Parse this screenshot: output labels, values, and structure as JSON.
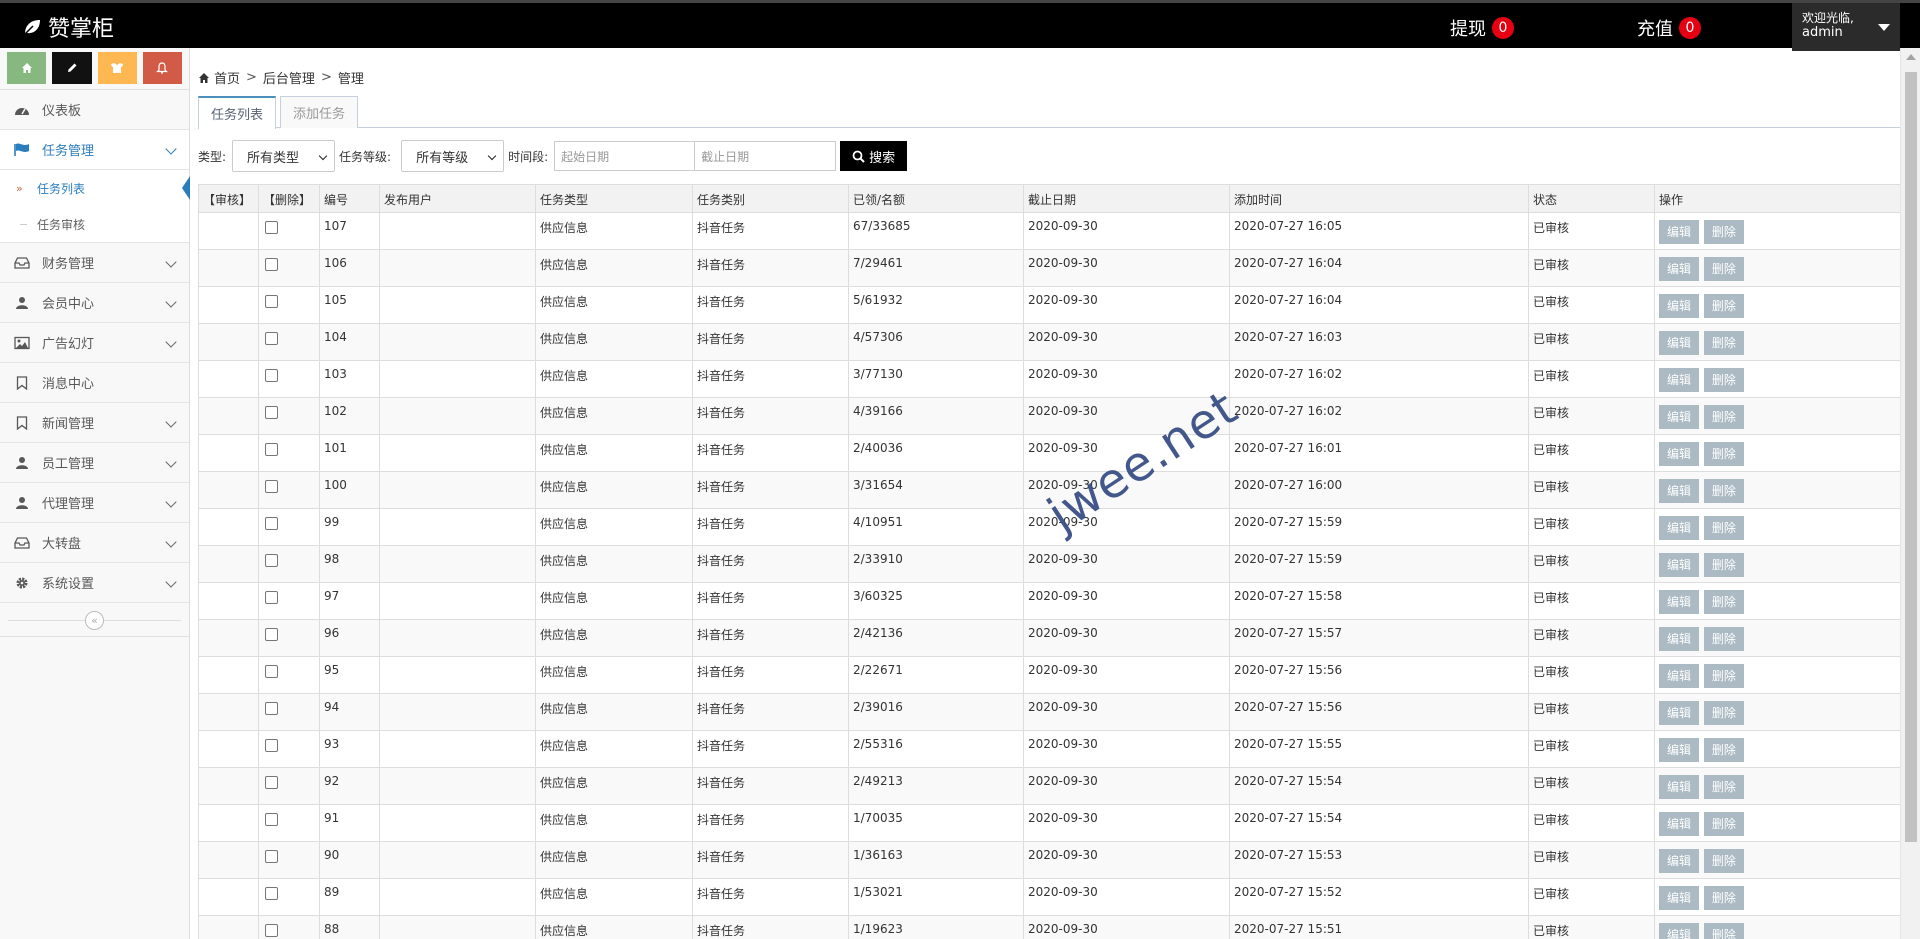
{
  "navbar": {
    "brand": "赞掌柜",
    "withdraw": {
      "label": "提现",
      "count": "0"
    },
    "recharge": {
      "label": "充值",
      "count": "0"
    },
    "user": {
      "welcome": "欢迎光临,",
      "name": "admin"
    }
  },
  "sidebar": {
    "shortcuts": [
      {
        "icon": "home-icon",
        "color": "#87b87f"
      },
      {
        "icon": "pencil-icon",
        "color": "#111111"
      },
      {
        "icon": "users-icon",
        "color": "#ffb752"
      },
      {
        "icon": "bell-icon",
        "color": "#d15b47"
      }
    ],
    "items": {
      "dashboard": "仪表板",
      "tasks": "任务管理",
      "task_list": "任务列表",
      "task_review": "任务审核",
      "finance": "财务管理",
      "members": "会员中心",
      "ads": "广告幻灯",
      "messages": "消息中心",
      "news": "新闻管理",
      "staff": "员工管理",
      "agents": "代理管理",
      "wheel": "大转盘",
      "settings": "系统设置"
    }
  },
  "breadcrumb": {
    "home": "首页",
    "sep1": ">",
    "admin": "后台管理",
    "sep2": ">",
    "manage": "管理"
  },
  "tabs": {
    "list": "任务列表",
    "add": "添加任务"
  },
  "filters": {
    "type_label": "类型:",
    "type_value": "所有类型",
    "level_label": "任务等级:",
    "level_value": "所有等级",
    "period_label": "时间段:",
    "start_placeholder": "起始日期",
    "end_placeholder": "截止日期",
    "search": "搜索"
  },
  "table": {
    "headers": [
      "【审核】",
      "【删除】",
      "编号",
      "发布用户",
      "任务类型",
      "任务类别",
      "已领/名额",
      "截止日期",
      "添加时间",
      "状态",
      "操作"
    ],
    "edit_label": "编辑",
    "delete_label": "删除",
    "rows": [
      {
        "id": "107",
        "type": "供应信息",
        "category": "抖音任务",
        "quota": "67/33685",
        "deadline": "2020-09-30",
        "added": "2020-07-27 16:05",
        "status": "已审核"
      },
      {
        "id": "106",
        "type": "供应信息",
        "category": "抖音任务",
        "quota": "7/29461",
        "deadline": "2020-09-30",
        "added": "2020-07-27 16:04",
        "status": "已审核"
      },
      {
        "id": "105",
        "type": "供应信息",
        "category": "抖音任务",
        "quota": "5/61932",
        "deadline": "2020-09-30",
        "added": "2020-07-27 16:04",
        "status": "已审核"
      },
      {
        "id": "104",
        "type": "供应信息",
        "category": "抖音任务",
        "quota": "4/57306",
        "deadline": "2020-09-30",
        "added": "2020-07-27 16:03",
        "status": "已审核"
      },
      {
        "id": "103",
        "type": "供应信息",
        "category": "抖音任务",
        "quota": "3/77130",
        "deadline": "2020-09-30",
        "added": "2020-07-27 16:02",
        "status": "已审核"
      },
      {
        "id": "102",
        "type": "供应信息",
        "category": "抖音任务",
        "quota": "4/39166",
        "deadline": "2020-09-30",
        "added": "2020-07-27 16:02",
        "status": "已审核"
      },
      {
        "id": "101",
        "type": "供应信息",
        "category": "抖音任务",
        "quota": "2/40036",
        "deadline": "2020-09-30",
        "added": "2020-07-27 16:01",
        "status": "已审核"
      },
      {
        "id": "100",
        "type": "供应信息",
        "category": "抖音任务",
        "quota": "3/31654",
        "deadline": "2020-09-30",
        "added": "2020-07-27 16:00",
        "status": "已审核"
      },
      {
        "id": "99",
        "type": "供应信息",
        "category": "抖音任务",
        "quota": "4/10951",
        "deadline": "2020-09-30",
        "added": "2020-07-27 15:59",
        "status": "已审核"
      },
      {
        "id": "98",
        "type": "供应信息",
        "category": "抖音任务",
        "quota": "2/33910",
        "deadline": "2020-09-30",
        "added": "2020-07-27 15:59",
        "status": "已审核"
      },
      {
        "id": "97",
        "type": "供应信息",
        "category": "抖音任务",
        "quota": "3/60325",
        "deadline": "2020-09-30",
        "added": "2020-07-27 15:58",
        "status": "已审核"
      },
      {
        "id": "96",
        "type": "供应信息",
        "category": "抖音任务",
        "quota": "2/42136",
        "deadline": "2020-09-30",
        "added": "2020-07-27 15:57",
        "status": "已审核"
      },
      {
        "id": "95",
        "type": "供应信息",
        "category": "抖音任务",
        "quota": "2/22671",
        "deadline": "2020-09-30",
        "added": "2020-07-27 15:56",
        "status": "已审核"
      },
      {
        "id": "94",
        "type": "供应信息",
        "category": "抖音任务",
        "quota": "2/39016",
        "deadline": "2020-09-30",
        "added": "2020-07-27 15:56",
        "status": "已审核"
      },
      {
        "id": "93",
        "type": "供应信息",
        "category": "抖音任务",
        "quota": "2/55316",
        "deadline": "2020-09-30",
        "added": "2020-07-27 15:55",
        "status": "已审核"
      },
      {
        "id": "92",
        "type": "供应信息",
        "category": "抖音任务",
        "quota": "2/49213",
        "deadline": "2020-09-30",
        "added": "2020-07-27 15:54",
        "status": "已审核"
      },
      {
        "id": "91",
        "type": "供应信息",
        "category": "抖音任务",
        "quota": "1/70035",
        "deadline": "2020-09-30",
        "added": "2020-07-27 15:54",
        "status": "已审核"
      },
      {
        "id": "90",
        "type": "供应信息",
        "category": "抖音任务",
        "quota": "1/36163",
        "deadline": "2020-09-30",
        "added": "2020-07-27 15:53",
        "status": "已审核"
      },
      {
        "id": "89",
        "type": "供应信息",
        "category": "抖音任务",
        "quota": "1/53021",
        "deadline": "2020-09-30",
        "added": "2020-07-27 15:52",
        "status": "已审核"
      },
      {
        "id": "88",
        "type": "供应信息",
        "category": "抖音任务",
        "quota": "1/19623",
        "deadline": "2020-09-30",
        "added": "2020-07-27 15:51",
        "status": "已审核"
      }
    ]
  },
  "watermark": "jwee.net",
  "colors": {
    "accent": "#2b7dbc",
    "badge": "#e60012",
    "op_button": "#abbac3"
  }
}
